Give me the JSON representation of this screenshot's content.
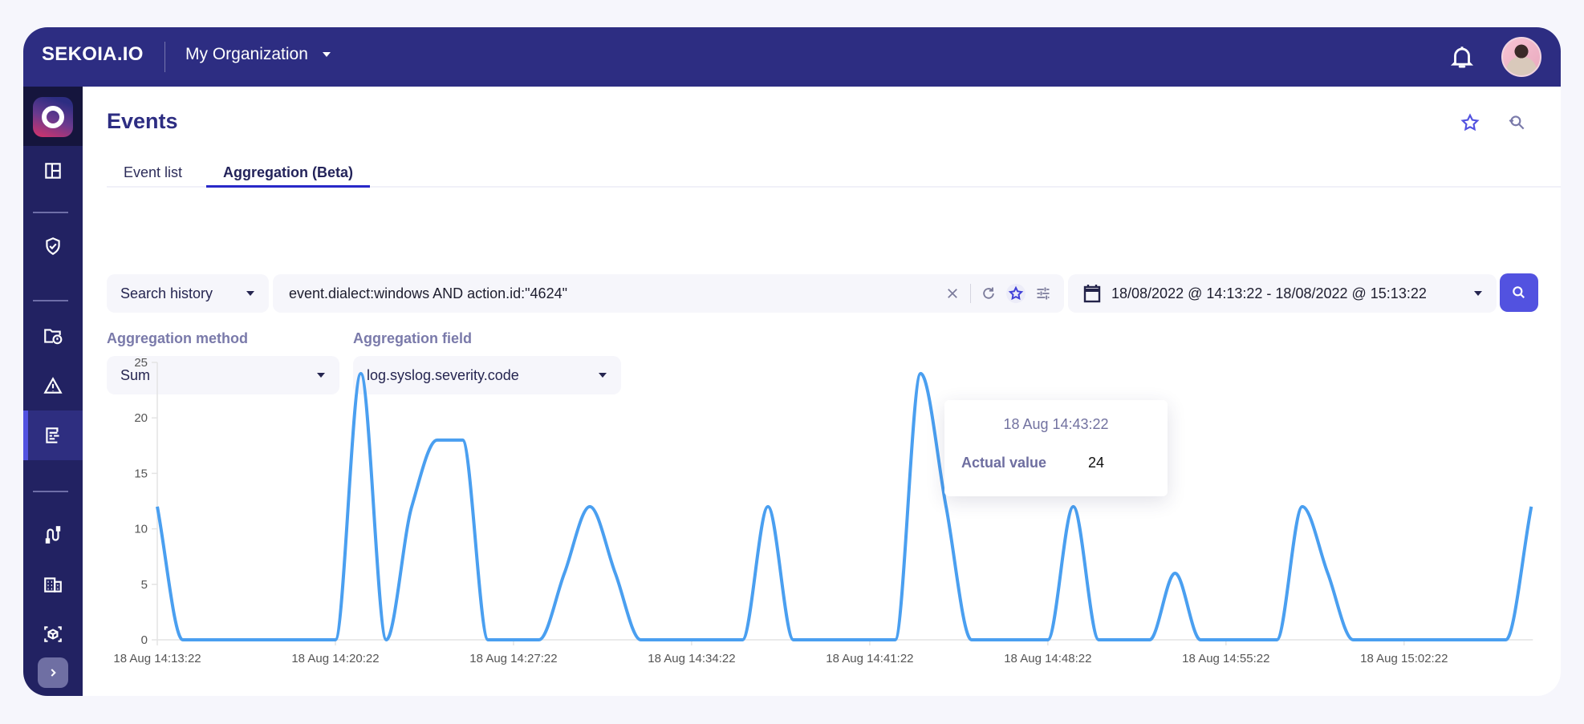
{
  "topbar": {
    "brand": "SEKOIA.IO",
    "organization": "My Organization",
    "icons": [
      "bell-icon",
      "avatar"
    ]
  },
  "sidebar": {
    "items": [
      {
        "name": "dashboard",
        "icon": "layout-icon",
        "active": false
      },
      {
        "name": "detection",
        "icon": "shield-check-icon",
        "active": false
      },
      {
        "name": "cases",
        "icon": "folder-alert-icon",
        "active": false
      },
      {
        "name": "alerts",
        "icon": "warning-icon",
        "active": false
      },
      {
        "name": "events",
        "icon": "events-list-icon",
        "active": true
      },
      {
        "name": "intakes",
        "icon": "cable-icon",
        "active": false
      },
      {
        "name": "entities",
        "icon": "building-icon",
        "active": false
      },
      {
        "name": "assets",
        "icon": "cube-scan-icon",
        "active": false
      }
    ],
    "expand_icon": "chevron-right-icon"
  },
  "page": {
    "title": "Events",
    "tabs": [
      {
        "label": "Event list",
        "active": false
      },
      {
        "label": "Aggregation (Beta)",
        "active": true
      }
    ]
  },
  "search": {
    "history_label": "Search history",
    "query": "event.dialect:windows AND action.id:\"4624\"",
    "date_range": "18/08/2022 @ 14:13:22 - 18/08/2022 @ 15:13:22"
  },
  "aggregation": {
    "method_label": "Aggregation method",
    "method_value": "Sum",
    "field_label": "Aggregation field",
    "field_value": "log.syslog.severity.code"
  },
  "tooltip": {
    "title": "18 Aug 14:43:22",
    "label": "Actual value",
    "value": "24"
  },
  "colors": {
    "topbar": "#2d2d82",
    "sidebar": "#222262",
    "accent": "#5252e0",
    "line": "#4a9ff0"
  },
  "chart_data": {
    "type": "line",
    "title": "",
    "xlabel": "",
    "ylabel": "",
    "series": [
      {
        "name": "Actual value",
        "values": [
          12,
          0,
          0,
          0,
          0,
          0,
          0,
          0,
          24,
          0,
          12,
          18,
          18,
          0,
          0,
          0,
          6,
          12,
          6,
          0,
          0,
          0,
          0,
          0,
          12,
          0,
          0,
          0,
          0,
          0,
          24,
          12,
          0,
          0,
          0,
          0,
          12,
          0,
          0,
          0,
          6,
          0,
          0,
          0,
          0,
          12,
          6,
          0,
          0,
          0,
          0,
          0,
          0,
          0,
          12
        ]
      }
    ],
    "x_start": "18 Aug 14:13:22",
    "x_step": "1 minute",
    "x_ticks": [
      "18 Aug 14:13:22",
      "18 Aug 14:20:22",
      "18 Aug 14:27:22",
      "18 Aug 14:34:22",
      "18 Aug 14:41:22",
      "18 Aug 14:48:22",
      "18 Aug 14:55:22",
      "18 Aug 15:02:22"
    ],
    "y_ticks": [
      0,
      5,
      10,
      15,
      20,
      25
    ],
    "ylim": [
      0,
      25
    ],
    "grid": false,
    "legend": "none"
  }
}
